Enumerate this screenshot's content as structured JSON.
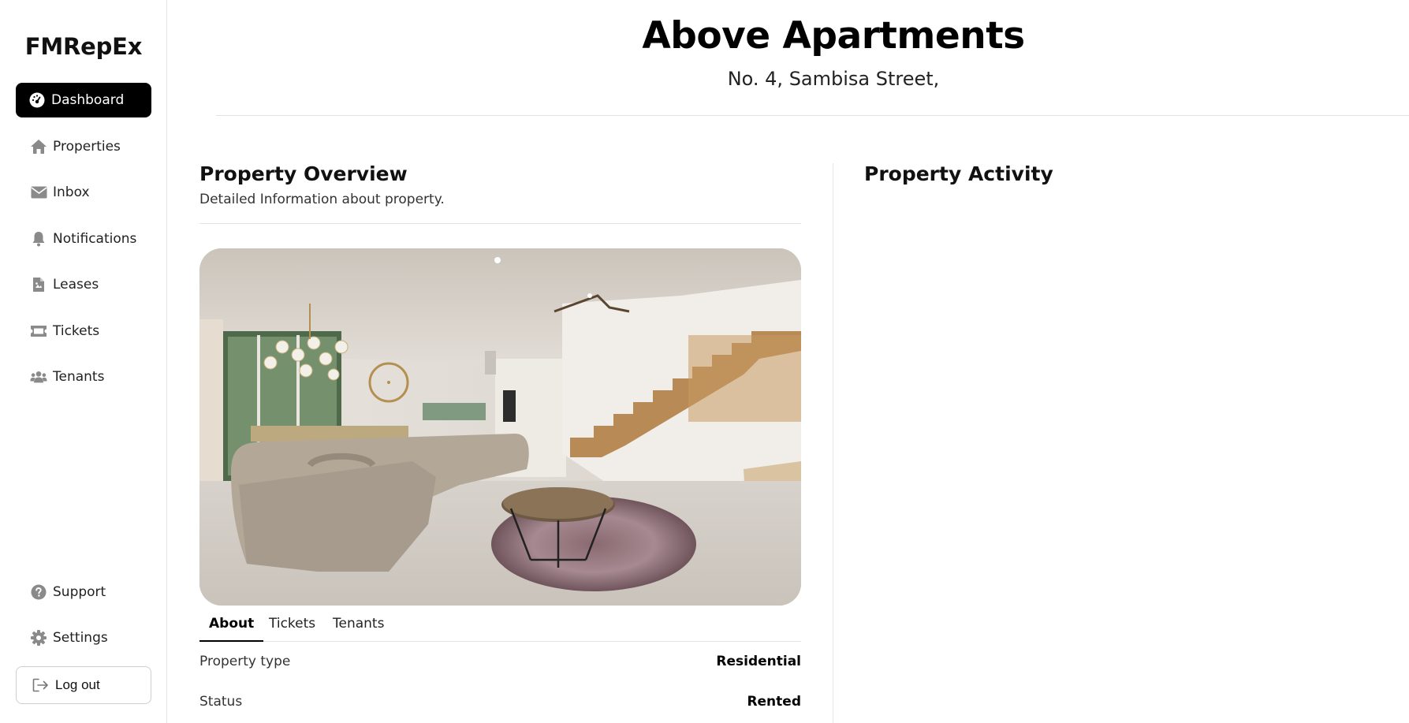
{
  "sidebar": {
    "brand": "FMRepEx",
    "items": [
      {
        "label": "Dashboard",
        "icon": "dashboard-icon",
        "active": true
      },
      {
        "label": "Properties",
        "icon": "home-icon"
      },
      {
        "label": "Inbox",
        "icon": "envelope-icon"
      },
      {
        "label": "Notifications",
        "icon": "bell-icon"
      },
      {
        "label": "Leases",
        "icon": "document-icon"
      },
      {
        "label": "Tickets",
        "icon": "ticket-icon"
      },
      {
        "label": "Tenants",
        "icon": "users-icon"
      }
    ],
    "bottom_items": [
      {
        "label": "Support",
        "icon": "question-icon"
      },
      {
        "label": "Settings",
        "icon": "gear-icon"
      }
    ],
    "logout_label": "Log out"
  },
  "header": {
    "title": "Above Apartments",
    "subtitle": "No. 4, Sambisa Street,"
  },
  "overview": {
    "title": "Property Overview",
    "description": "Detailed Information about property.",
    "tabs": [
      "About",
      "Tickets",
      "Tenants"
    ],
    "active_tab": "About",
    "details": [
      {
        "label": "Property type",
        "value": "Residential"
      },
      {
        "label": "Status",
        "value": "Rented"
      }
    ]
  },
  "activity": {
    "title": "Property Activity"
  },
  "colors": {
    "active_nav_bg": "#000000",
    "icon_gray": "#8a8a8a"
  }
}
